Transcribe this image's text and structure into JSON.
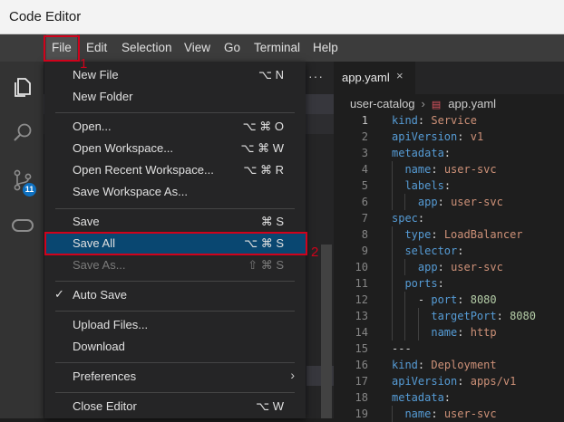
{
  "window": {
    "title": "Code Editor"
  },
  "menubar": {
    "items": [
      "File",
      "Edit",
      "Selection",
      "View",
      "Go",
      "Terminal",
      "Help"
    ]
  },
  "activity": {
    "scm_badge": "11"
  },
  "tab": {
    "label": "app.yaml",
    "close": "×"
  },
  "more_actions": "···",
  "breadcrumb": {
    "folder": "user-catalog",
    "separator": "›",
    "file": "app.yaml"
  },
  "file_menu": [
    {
      "label": "New File",
      "shortcut": "⌥ N"
    },
    {
      "label": "New Folder",
      "shortcut": ""
    },
    {
      "label": "Open...",
      "shortcut": "⌥ ⌘ O"
    },
    {
      "label": "Open Workspace...",
      "shortcut": "⌥ ⌘ W"
    },
    {
      "label": "Open Recent Workspace...",
      "shortcut": "⌥ ⌘ R"
    },
    {
      "label": "Save Workspace As...",
      "shortcut": ""
    },
    {
      "label": "Save",
      "shortcut": "⌘ S"
    },
    {
      "label": "Save All",
      "shortcut": "⌥ ⌘ S"
    },
    {
      "label": "Save As...",
      "shortcut": "⇧ ⌘ S"
    },
    {
      "label": "Auto Save",
      "check": "✓"
    },
    {
      "label": "Upload Files...",
      "shortcut": ""
    },
    {
      "label": "Download",
      "shortcut": ""
    },
    {
      "label": "Preferences",
      "arrow": "›"
    },
    {
      "label": "Close Editor",
      "shortcut": "⌥ W"
    }
  ],
  "annotations": {
    "step1": "1",
    "step2": "2"
  },
  "code_lines": [
    {
      "n": "1",
      "indent": "",
      "key": "kind",
      "val": "Service",
      "vtype": "v"
    },
    {
      "n": "2",
      "indent": "",
      "key": "apiVersion",
      "val": "v1",
      "vtype": "v"
    },
    {
      "n": "3",
      "indent": "",
      "key": "metadata",
      "val": "",
      "vtype": "v"
    },
    {
      "n": "4",
      "indent": "  ",
      "key": "name",
      "val": "user-svc",
      "vtype": "v"
    },
    {
      "n": "5",
      "indent": "  ",
      "key": "labels",
      "val": "",
      "vtype": "v"
    },
    {
      "n": "6",
      "indent": "    ",
      "key": "app",
      "val": "user-svc",
      "vtype": "v"
    },
    {
      "n": "7",
      "indent": "",
      "key": "spec",
      "val": "",
      "vtype": "v"
    },
    {
      "n": "8",
      "indent": "  ",
      "key": "type",
      "val": "LoadBalancer",
      "vtype": "v"
    },
    {
      "n": "9",
      "indent": "  ",
      "key": "selector",
      "val": "",
      "vtype": "v"
    },
    {
      "n": "10",
      "indent": "    ",
      "key": "app",
      "val": "user-svc",
      "vtype": "v"
    },
    {
      "n": "11",
      "indent": "  ",
      "key": "ports",
      "val": "",
      "vtype": "v"
    },
    {
      "n": "12",
      "indent": "    - ",
      "key": "port",
      "val": "8080",
      "vtype": "n"
    },
    {
      "n": "13",
      "indent": "      ",
      "key": "targetPort",
      "val": "8080",
      "vtype": "n"
    },
    {
      "n": "14",
      "indent": "      ",
      "key": "name",
      "val": "http",
      "vtype": "v"
    },
    {
      "n": "15",
      "indent": "",
      "key": "",
      "val": "---",
      "vtype": "plain"
    },
    {
      "n": "16",
      "indent": "",
      "key": "kind",
      "val": "Deployment",
      "vtype": "v"
    },
    {
      "n": "17",
      "indent": "",
      "key": "apiVersion",
      "val": "apps/v1",
      "vtype": "v"
    },
    {
      "n": "18",
      "indent": "",
      "key": "metadata",
      "val": "",
      "vtype": "v"
    },
    {
      "n": "19",
      "indent": "  ",
      "key": "name",
      "val": "user-svc",
      "vtype": "v"
    }
  ],
  "colors": {
    "accent": "#0e70c0",
    "highlight": "#094771",
    "annotation": "#d0021b"
  }
}
